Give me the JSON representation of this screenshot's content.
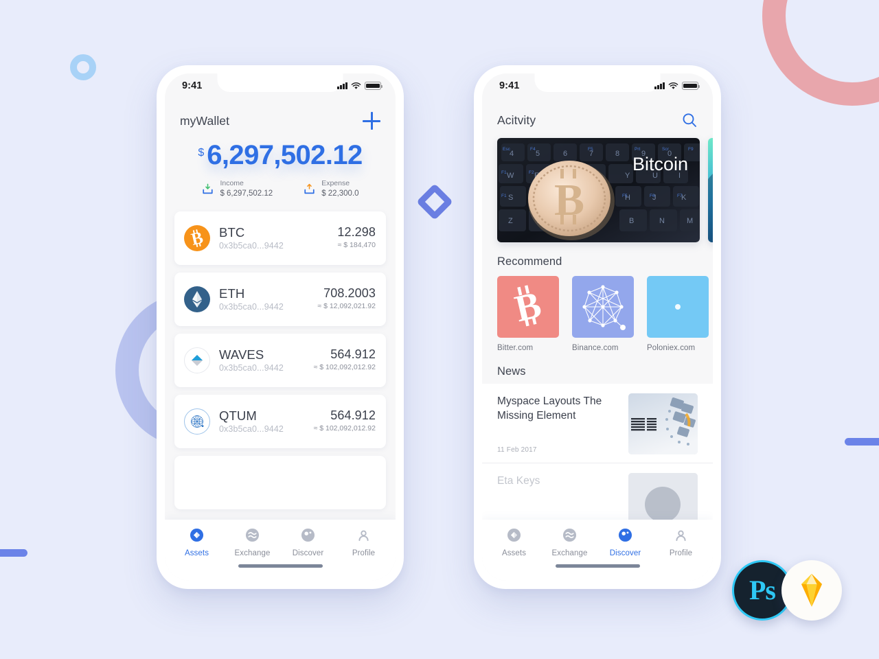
{
  "statusbar": {
    "time": "9:41",
    "signal_icon": "signal-bars-icon",
    "wifi_icon": "wifi-icon",
    "battery_icon": "battery-icon"
  },
  "wallet": {
    "title": "myWallet",
    "add_button_icon": "plus-icon",
    "balance_currency": "$",
    "balance_amount": "6,297,502.12",
    "balance_color": "#2f6fe4",
    "income": {
      "label": "Income",
      "value": "$ 6,297,502.12",
      "icon": "download-tray-icon",
      "arrow_color": "#3fbf6f"
    },
    "expense": {
      "label": "Expense",
      "value": "$ 22,300.0",
      "icon": "upload-tray-icon",
      "arrow_color": "#f5941f"
    },
    "assets": [
      {
        "symbol": "BTC",
        "address": "0x3b5ca0...9442",
        "amount": "12.298",
        "fiat": "≈ $ 184,470",
        "icon": "bitcoin-coin-icon",
        "color": "#f7931a"
      },
      {
        "symbol": "ETH",
        "address": "0x3b5ca0...9442",
        "amount": "708.2003",
        "fiat": "≈ $ 12,092,021.92",
        "icon": "ethereum-coin-icon",
        "color": "#33618a"
      },
      {
        "symbol": "WAVES",
        "address": "0x3b5ca0...9442",
        "amount": "564.912",
        "fiat": "≈ $ 102,092,012.92",
        "icon": "waves-coin-icon",
        "color": "#1f9ed9"
      },
      {
        "symbol": "QTUM",
        "address": "0x3b5ca0...9442",
        "amount": "564.912",
        "fiat": "≈ $ 102,092,012.92",
        "icon": "qtum-coin-icon",
        "color": "#2c74c4"
      }
    ]
  },
  "discover": {
    "title": "Acitvity",
    "search_icon": "search-icon",
    "banners": [
      {
        "caption": "Bitcoin",
        "icon": "bitcoin-keyboard-photo"
      },
      {
        "caption": "",
        "icon": "abstract-teal-photo"
      }
    ],
    "recommend_title": "Recommend",
    "recommend": [
      {
        "name": "Bitter.com",
        "color": "#f08a84",
        "icon": "bitcoin-b-icon"
      },
      {
        "name": "Binance.com",
        "color": "#93a7ec",
        "icon": "network-graph-icon"
      },
      {
        "name": "Poloniex.com",
        "color": "#74c9f5",
        "icon": "poloniex-icon"
      }
    ],
    "news_title": "News",
    "news": [
      {
        "headline": "Myspace Layouts The Missing Element",
        "date": "11 Feb 2017",
        "thumb_icon": "ibm-server-photo"
      },
      {
        "headline": "Eta Keys",
        "date": "",
        "thumb_icon": "portrait-photo"
      }
    ]
  },
  "tabbar": {
    "items": [
      {
        "label": "Assets",
        "icon": "assets-diamond-icon"
      },
      {
        "label": "Exchange",
        "icon": "exchange-waves-icon"
      },
      {
        "label": "Discover",
        "icon": "discover-compass-icon"
      },
      {
        "label": "Profile",
        "icon": "profile-person-icon"
      }
    ],
    "left_active": "Assets",
    "right_active": "Discover",
    "active_color": "#2f6fe4",
    "inactive_color": "#b6bbc7",
    "home_indicator": "home-indicator-bar"
  },
  "branding": {
    "photoshop_label": "Ps",
    "photoshop_icon": "photoshop-logo-icon",
    "sketch_icon": "sketch-diamond-logo-icon"
  },
  "decor": {
    "background_color": "#e8ecfb",
    "pink_ring": "#e8a6ac",
    "periwinkle_ring": "#b9c3ef",
    "small_ring": "#a8d2f7",
    "bar_color": "#6b83e8",
    "diamond_color": "#6b7fe3"
  }
}
